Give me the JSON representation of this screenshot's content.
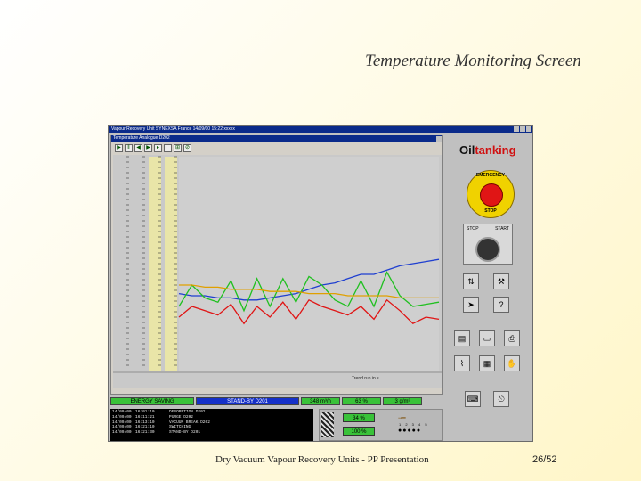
{
  "slide": {
    "title": "Temperature Monitoring Screen",
    "footer": "Dry Vacuum Vapour Recovery Units - PP Presentation",
    "page": "26/52"
  },
  "app": {
    "title": "Vapour Recovery Unit SYNEXSA France 14/09/00 15:22 xxxxx",
    "inner_title": "Temperature Analogue D202",
    "x_label_right": "Trend run in s",
    "brand_prefix": "Oil",
    "brand_suffix": "tanking",
    "estop_top": "EMERGENCY",
    "estop_bottom": "STOP",
    "stop_label": "STOP",
    "start_label": "START"
  },
  "status": {
    "mode": "ENERGY SAVING",
    "state": "STAND-BY D201",
    "flow": "348 m³/h",
    "percent": "63 %",
    "concentration": "3 g/m³"
  },
  "log": [
    {
      "date": "14/09/00",
      "time": "16:01:10",
      "event": "DESORPTION D202"
    },
    {
      "date": "14/09/00",
      "time": "16:11:21",
      "event": "PURGE D202"
    },
    {
      "date": "14/09/00",
      "time": "16:13:10",
      "event": "VACUUM BREAK D202"
    },
    {
      "date": "14/09/00",
      "time": "16:21:10",
      "event": "SWITCHING"
    },
    {
      "date": "14/09/00",
      "time": "16:21:30",
      "event": "STAND-BY D201"
    }
  ],
  "bottom": {
    "pct1": "34 %",
    "pct2": "100 %",
    "indices": "1 2 3 4 5"
  },
  "chart_data": {
    "type": "line",
    "x": [
      0,
      5,
      10,
      15,
      20,
      25,
      30,
      35,
      40,
      45,
      50,
      55,
      60,
      65,
      70,
      75,
      80,
      85,
      90,
      95,
      100
    ],
    "ylim": [
      0,
      100
    ],
    "series": [
      {
        "color": "#1f3fd0",
        "values": [
          36,
          35,
          35,
          34,
          34,
          33,
          33,
          34,
          35,
          36,
          38,
          40,
          41,
          43,
          45,
          45,
          47,
          49,
          50,
          51,
          52
        ]
      },
      {
        "color": "#e01414",
        "values": [
          25,
          30,
          28,
          26,
          31,
          22,
          30,
          25,
          32,
          24,
          33,
          30,
          28,
          26,
          30,
          24,
          33,
          28,
          22,
          25,
          24
        ]
      },
      {
        "color": "#20c020",
        "values": [
          30,
          40,
          34,
          32,
          42,
          28,
          43,
          30,
          43,
          32,
          44,
          40,
          33,
          30,
          42,
          30,
          46,
          35,
          30,
          31,
          32
        ]
      },
      {
        "color": "#e0a000",
        "values": [
          40,
          40,
          39,
          39,
          38,
          38,
          38,
          37,
          37,
          37,
          36,
          36,
          36,
          35,
          35,
          35,
          35,
          34,
          34,
          34,
          34
        ]
      }
    ]
  },
  "colors": {
    "accent_green": "#39c239",
    "accent_blue": "#1530c8",
    "window_title": "#0a2a8a"
  }
}
